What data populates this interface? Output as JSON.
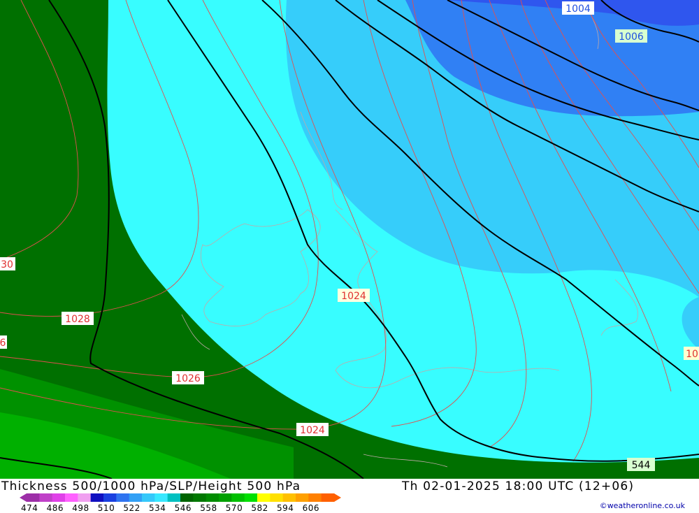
{
  "map": {
    "title": "Thickness 500/1000 hPa/SLP/Height 500 hPa",
    "valid_time": "Th 02-01-2025 18:00 UTC (12+06)",
    "credit": "©weatheronline.co.uk",
    "isobar_labels": [
      "1004",
      "1006",
      "30",
      "1028",
      "6",
      "1024",
      "1026",
      "1024",
      "10"
    ],
    "height_labels": [
      "544"
    ],
    "legend": {
      "values": [
        "474",
        "486",
        "498",
        "510",
        "522",
        "534",
        "546",
        "558",
        "570",
        "582",
        "594",
        "606"
      ],
      "colors": [
        "#9d2fa8",
        "#c040c8",
        "#e040e8",
        "#ff60ff",
        "#f0a0f0",
        "#1010c0",
        "#1a40e0",
        "#2f74f0",
        "#32a0f5",
        "#35c8fa",
        "#38e8ff",
        "#00c0c0",
        "#006400",
        "#007800",
        "#008c00",
        "#00a000",
        "#00c000",
        "#00e000",
        "#ffff00",
        "#ffe000",
        "#ffc000",
        "#ffa000",
        "#ff8000",
        "#ff6000"
      ]
    },
    "colors": {
      "dark_green": "#007000",
      "mid_green": "#009100",
      "light_green": "#00b000",
      "cyan": "#38fdff",
      "light_blue": "#36cdfa",
      "blue": "#3a9ff7",
      "dark_blue": "#2f72f2",
      "isobar": "#e05050",
      "height_contour": "#000000",
      "coastline": "#b0a0a0"
    }
  }
}
